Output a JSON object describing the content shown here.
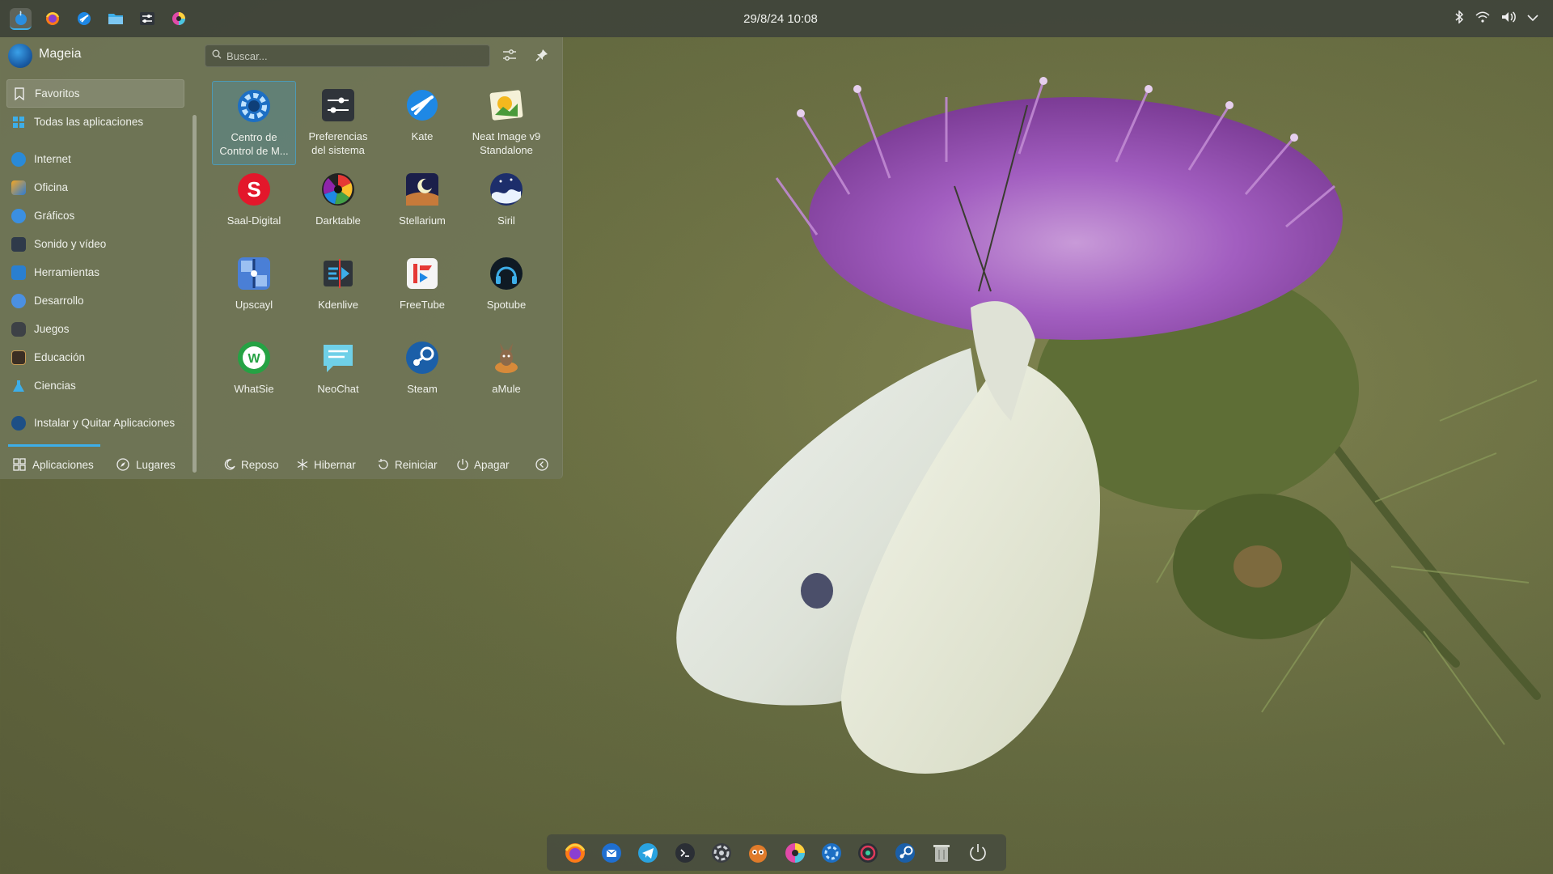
{
  "panel": {
    "clock": "29/8/24 10:08",
    "launchers": [
      "mageia-menu-icon",
      "firefox-icon",
      "kate-icon",
      "file-manager-icon",
      "system-settings-icon",
      "app-color-icon"
    ],
    "tray": [
      "bluetooth-icon",
      "wifi-icon",
      "volume-icon",
      "chevron-down-icon"
    ]
  },
  "menu": {
    "user": "Mageia",
    "search": {
      "placeholder": "Buscar...",
      "value": ""
    },
    "categories": [
      {
        "label": "Favoritos",
        "icon": "bookmark-icon"
      },
      {
        "label": "Todas las aplicaciones",
        "icon": "grid-icon"
      },
      {
        "label": "Internet",
        "icon": "globe-icon"
      },
      {
        "label": "Oficina",
        "icon": "office-icon"
      },
      {
        "label": "Gráficos",
        "icon": "graphics-icon"
      },
      {
        "label": "Sonido y vídeo",
        "icon": "multimedia-icon"
      },
      {
        "label": "Herramientas",
        "icon": "tools-icon"
      },
      {
        "label": "Desarrollo",
        "icon": "development-icon"
      },
      {
        "label": "Juegos",
        "icon": "gamepad-icon"
      },
      {
        "label": "Educación",
        "icon": "education-icon"
      },
      {
        "label": "Ciencias",
        "icon": "science-icon"
      },
      {
        "label": "Instalar y Quitar Aplicaciones",
        "icon": "install-icon"
      }
    ],
    "apps": [
      {
        "line1": "Centro de",
        "line2": "Control de M...",
        "icon": "control-center-icon"
      },
      {
        "line1": "Preferencias",
        "line2": "del sistema",
        "icon": "system-settings-icon"
      },
      {
        "line1": "Kate",
        "line2": "",
        "icon": "kate-icon"
      },
      {
        "line1": "Neat Image v9",
        "line2": "Standalone",
        "icon": "neat-image-icon"
      },
      {
        "line1": "Saal-Digital",
        "line2": "",
        "icon": "saal-digital-icon"
      },
      {
        "line1": "Darktable",
        "line2": "",
        "icon": "darktable-icon"
      },
      {
        "line1": "Stellarium",
        "line2": "",
        "icon": "stellarium-icon"
      },
      {
        "line1": "Siril",
        "line2": "",
        "icon": "siril-icon"
      },
      {
        "line1": "Upscayl",
        "line2": "",
        "icon": "upscayl-icon"
      },
      {
        "line1": "Kdenlive",
        "line2": "",
        "icon": "kdenlive-icon"
      },
      {
        "line1": "FreeTube",
        "line2": "",
        "icon": "freetube-icon"
      },
      {
        "line1": "Spotube",
        "line2": "",
        "icon": "spotube-icon"
      },
      {
        "line1": "WhatSie",
        "line2": "",
        "icon": "whatsie-icon"
      },
      {
        "line1": "NeoChat",
        "line2": "",
        "icon": "neochat-icon"
      },
      {
        "line1": "Steam",
        "line2": "",
        "icon": "steam-icon"
      },
      {
        "line1": "aMule",
        "line2": "",
        "icon": "amule-icon"
      }
    ],
    "footer": {
      "tab_apps": "Aplicaciones",
      "tab_places": "Lugares",
      "sleep": "Reposo",
      "hibernate": "Hibernar",
      "restart": "Reiniciar",
      "shutdown": "Apagar"
    }
  },
  "dock": [
    "firefox-icon",
    "thunderbird-icon",
    "telegram-icon",
    "terminal-icon",
    "aperture-icon",
    "gimp-icon",
    "app-color-icon",
    "mageia-control-icon",
    "record-icon",
    "steam-icon",
    "trash-icon",
    "power-icon"
  ],
  "colors": {
    "accent": "#3daee9",
    "panel": "#3e423a",
    "wallpaper": "#6f7446"
  }
}
